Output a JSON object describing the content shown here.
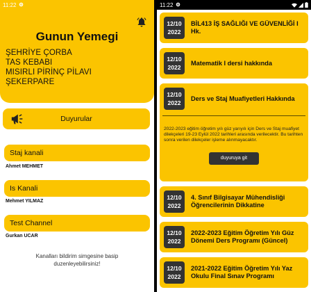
{
  "status_bar": {
    "time": "11:22"
  },
  "left": {
    "title": "Gunun Yemegi",
    "menu": [
      "ŞEHRİYE ÇORBA",
      "TAS KEBABI",
      "MISIRLI PİRİNÇ PİLAVI",
      "ŞEKERPARE"
    ],
    "announcements_label": "Duyurular",
    "channels": [
      {
        "name": "Staj kanali",
        "owner": "Ahmet MEHMET"
      },
      {
        "name": "Is Kanali",
        "owner": "Mehmet YILMAZ"
      },
      {
        "name": "Test Channel",
        "owner": "Gurkan UCAR"
      }
    ],
    "footer_line1": "Kanalları bildirim simgesine basip",
    "footer_line2": "duzenleyebilirsiniz!"
  },
  "right": {
    "cards": [
      {
        "day": "12/10",
        "year": "2022",
        "title": "BİL413 İŞ SAĞLIĞI VE GÜVENLİĞİ I Hk."
      },
      {
        "day": "12/10",
        "year": "2022",
        "title": "Matematik I dersi hakkında"
      },
      {
        "day": "12/10",
        "year": "2022",
        "title": "Ders ve Staj Muafiyetleri Hakkında",
        "body": "2022-2023 eğitim öğretim yılı güz yarıyılı için Ders ve Staj muafiyet dilekçeleri 19-23 Eylül 2022 tarihleri arasında verilecektir. Bu tarihten sonra verilen dilekçeler işleme alınmayacaktır.",
        "button": "duyuruya git"
      },
      {
        "day": "12/10",
        "year": "2022",
        "title": "4. Sınıf Bilgisayar Mühendisliği Öğrencilerinin Dikkatine"
      },
      {
        "day": "12/10",
        "year": "2022",
        "title": "2022-2023 Eğitim Öğretim Yılı Güz Dönemi Ders Programı (Güncel)"
      },
      {
        "day": "12/10",
        "year": "2022",
        "title": "2021-2022 Eğitim Öğretim Yılı Yaz Okulu Final Sınav Programı"
      }
    ]
  },
  "colors": {
    "accent": "#fbc400",
    "dark": "#333333"
  }
}
